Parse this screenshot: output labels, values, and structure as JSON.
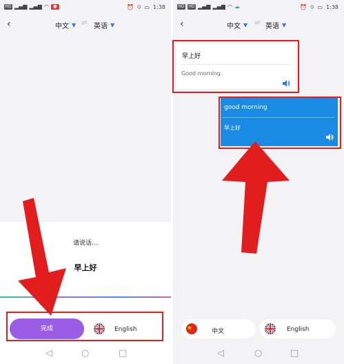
{
  "status_bar": {
    "time": "1:38",
    "left_chip": "HD",
    "right_chip_left": "HD",
    "right_chip_right": "HD"
  },
  "header": {
    "source_lang": "中文",
    "target_lang": "英语"
  },
  "left_panel": {
    "prompt": "请说话…",
    "recognized": "早上好",
    "done_label": "完成",
    "english_label": "English"
  },
  "right_panel": {
    "source_card": {
      "title": "早上好",
      "translation": "Good morning."
    },
    "result_card": {
      "title": "good morning",
      "translation": "早上好"
    },
    "chinese_label": "中文",
    "english_label": "English"
  },
  "colors": {
    "accent": "#2f7ae5",
    "done_button": "#9b5ce6",
    "result_card": "#1a8ae2",
    "annotation": "#e11d1d"
  }
}
